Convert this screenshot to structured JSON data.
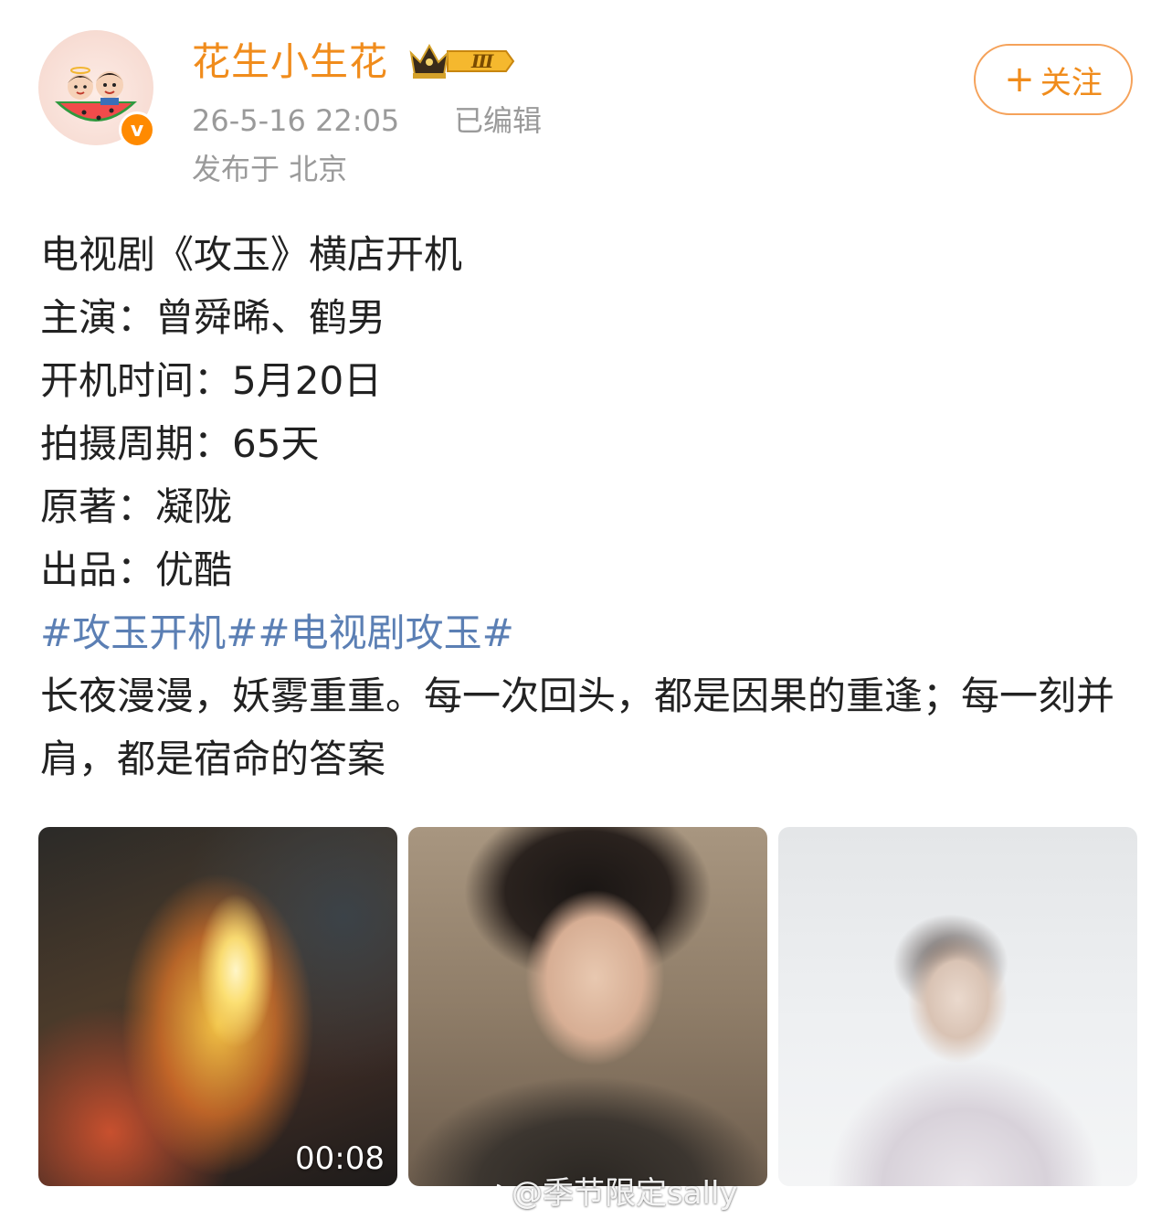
{
  "author": {
    "name": "花生小生花",
    "level_badge": "Ⅲ",
    "verified_mark": "v",
    "timestamp": "26-5-16 22:05",
    "edited": "已编辑",
    "location": "发布于 北京"
  },
  "follow_button": {
    "plus": "+",
    "label": "关注"
  },
  "post": {
    "lines": [
      "电视剧《攻玉》横店开机",
      "主演：曾舜晞、鹤男",
      "开机时间：5月20日",
      "拍摄周期：65天",
      "原著：凝陇",
      "出品：优酷"
    ],
    "hashtags": "#攻玉开机##电视剧攻玉#",
    "body": "长夜漫漫，妖雾重重。每一次回头，都是因果的重逢；每一刻并肩，都是宿命的答案"
  },
  "media": {
    "video_duration": "00:08",
    "watermark": "@季节限定sally",
    "watermark_icon": "weibo-icon"
  },
  "colors": {
    "accent": "#f08c1c",
    "hashtag": "#5b7fb4",
    "meta": "#9a9a9a",
    "text": "#222222"
  }
}
